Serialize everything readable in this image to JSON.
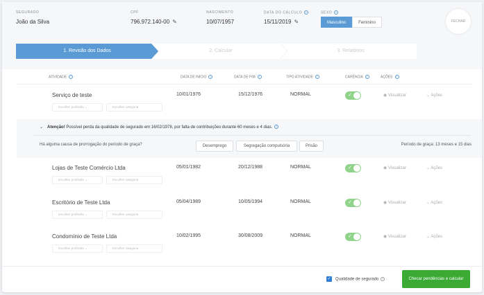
{
  "header": {
    "segurado": {
      "label": "SEGURADO",
      "value": "João da Silva"
    },
    "cpf": {
      "label": "CPF",
      "value": "796.972.140-00"
    },
    "nascimento": {
      "label": "NASCIMENTO",
      "value": "10/07/1957"
    },
    "data_calculo": {
      "label": "DATA DO CÁLCULO",
      "value": "15/11/2019"
    },
    "sexo": {
      "label": "SEXO",
      "options": [
        "Masculino",
        "Feminino"
      ],
      "selected": "Masculino"
    },
    "close_label": "FECHAR"
  },
  "steps": [
    "1. Revisão dos Dados",
    "2. Calcular",
    "3. Relatórios"
  ],
  "columns": [
    "ATIVIDADE",
    "DATA DE INÍCIO",
    "DATA DE FIM",
    "TIPO ATIVIDADE",
    "CARÊNCIA",
    "AÇÕES"
  ],
  "rows": [
    {
      "name": "Serviço de teste",
      "inicio": "10/01/1976",
      "fim": "15/12/1976",
      "tipo": "NORMAL"
    },
    {
      "name": "Lojas de Teste Comércio Ltda",
      "inicio": "05/01/1982",
      "fim": "20/12/1988",
      "tipo": "NORMAL"
    },
    {
      "name": "Escritório de Teste Ltda",
      "inicio": "05/04/1989",
      "fim": "10/05/1994",
      "tipo": "NORMAL"
    },
    {
      "name": "Condomínio de Teste Ltda",
      "inicio": "10/02/1995",
      "fim": "30/08/2009",
      "tipo": "NORMAL"
    }
  ],
  "row_controls": {
    "profissao": "Escolher profissão",
    "categoria": "Escolher categoria",
    "visualizar": "Visualizar",
    "acoes": "Ações"
  },
  "alert": {
    "strong": "Atenção!",
    "text": " Possível perda da qualidade de segurado em 16/02/1978, por falta de contribuições durante 60 meses e 4 dias.",
    "question": "Há alguma causa de prorrogação do período de graça?",
    "buttons": [
      "Desemprego",
      "Segregação compulsória",
      "Prisão"
    ],
    "periodo": "Período de graça: 13 meses e 15 dias"
  },
  "footer": {
    "checkbox_label": "Qualidade de segurado",
    "checked": true,
    "submit": "Checar pendências e calcular"
  },
  "colors": {
    "primary": "#5b9bd5",
    "success": "#3aaa35",
    "toggle": "#8fd48a"
  }
}
